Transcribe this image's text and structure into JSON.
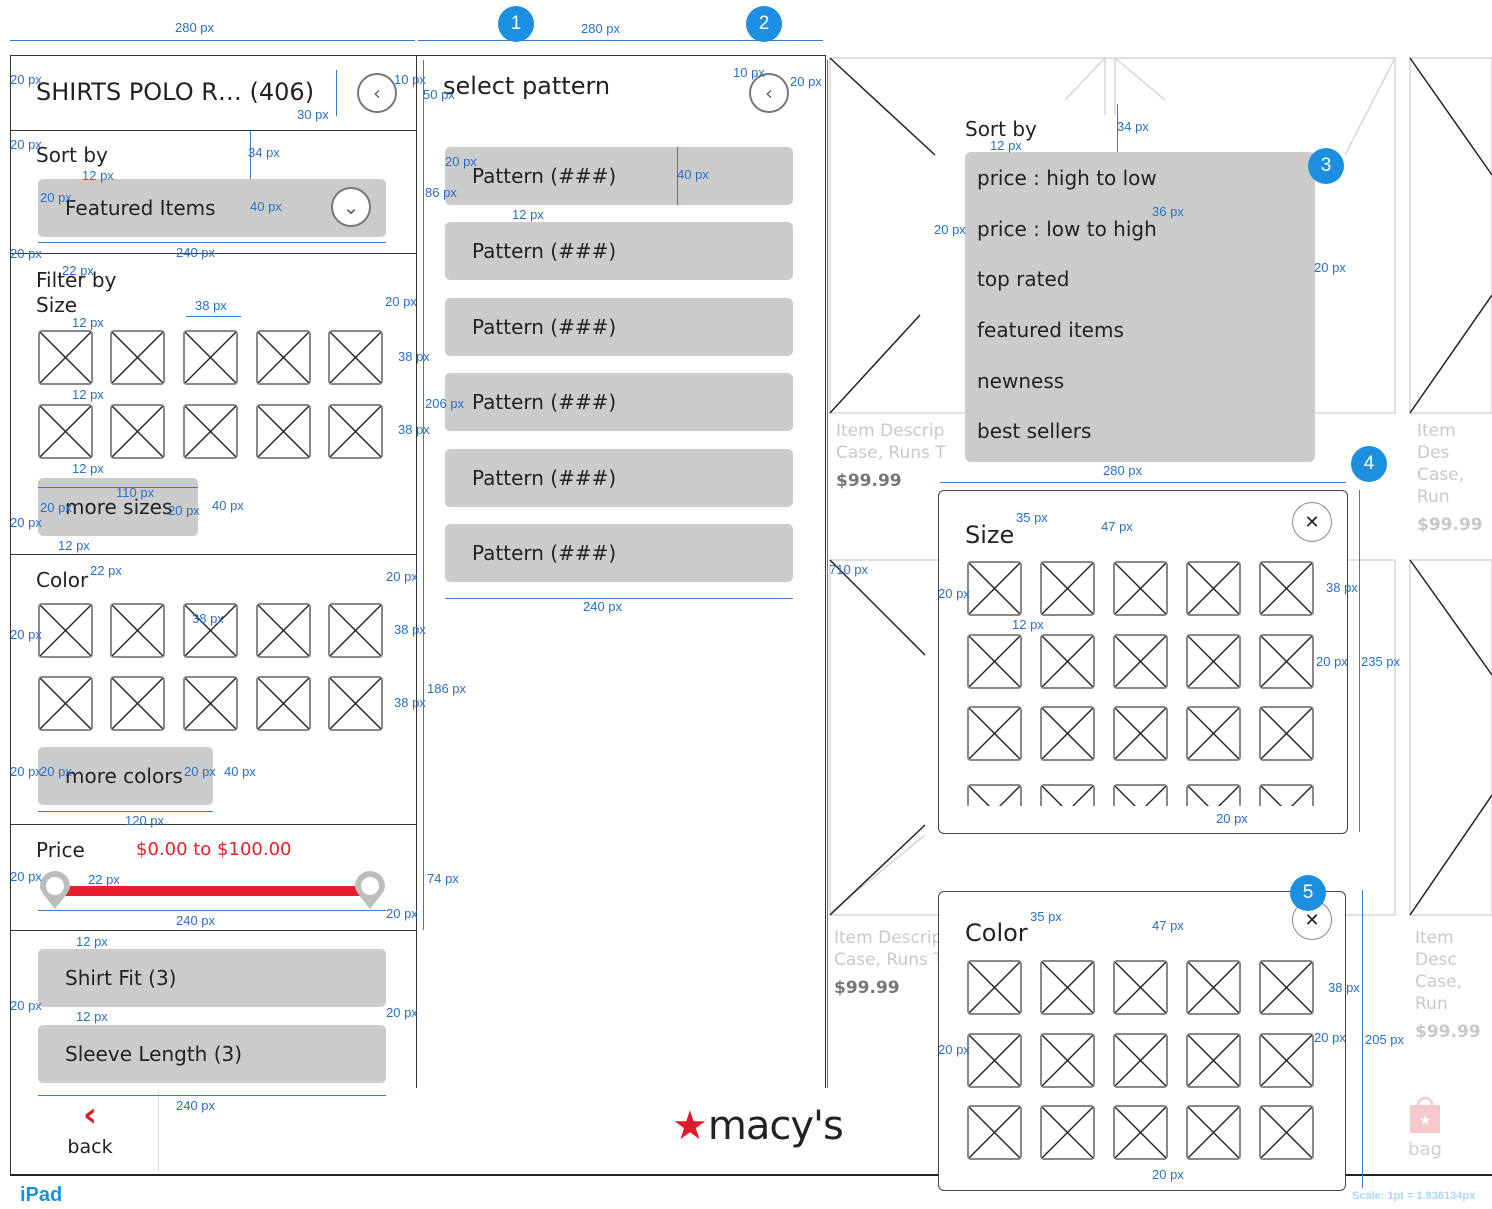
{
  "left_panel": {
    "title": "SHIRTS POLO R… (406)",
    "sort_heading": "Sort by",
    "sort_value": "Featured Items",
    "filter_heading": "Filter by",
    "size_heading": "Size",
    "more_sizes": "more sizes",
    "color_heading": "Color",
    "more_colors": "more colors",
    "price_heading": "Price",
    "price_range": "$0.00 to $100.00",
    "shirt_fit": "Shirt Fit (3)",
    "sleeve_length": "Sleeve Length (3)"
  },
  "pattern_panel": {
    "title": "select pattern",
    "items": [
      "Pattern (###)",
      "Pattern (###)",
      "Pattern (###)",
      "Pattern (###)",
      "Pattern (###)",
      "Pattern (###)"
    ]
  },
  "sort_dropdown": {
    "heading": "Sort by",
    "options": [
      "price : high to low",
      "price : low to high",
      "top rated",
      "featured items",
      "newness",
      "best sellers"
    ]
  },
  "size_popup": {
    "heading": "Size"
  },
  "color_popup": {
    "heading": "Color"
  },
  "products": [
    {
      "desc_line1": "Item Descrip",
      "desc_line2": "Case, Runs T",
      "price": "$99.99"
    },
    {
      "desc_line1": "Item Descrip",
      "desc_line2": "Case, Runs T",
      "price": "$99.99"
    },
    {
      "desc_line1": "Item Des",
      "desc_line2": "Case, Run",
      "price": "$99.99"
    },
    {
      "desc_line1": "Item Desc",
      "desc_line2": "Case, Run",
      "price": "$99.99"
    }
  ],
  "bottom_bar": {
    "back_label": "back",
    "brand": "macy's",
    "bag_label": "bag"
  },
  "badges": [
    "1",
    "2",
    "3",
    "4",
    "5"
  ],
  "device_label": "iPad",
  "scale_note": "Scale: 1pt = 1.836134px",
  "measurements": {
    "w280a": "280 px",
    "w280b": "280 px",
    "w280c": "280 px",
    "p20": "20 px",
    "p10": "10 px",
    "p50": "50 px",
    "p30": "30 px",
    "p34": "34 px",
    "p12": "12 px",
    "p40": "40 px",
    "p240": "240 px",
    "p22": "22 px",
    "p38": "38 px",
    "p110": "110 px",
    "p120": "120 px",
    "p86": "86 px",
    "p206": "206 px",
    "p186": "186 px",
    "p74": "74 px",
    "p710": "710 px",
    "p36": "36 px",
    "p35": "35 px",
    "p47": "47 px",
    "p235": "235 px",
    "p205": "205 px"
  },
  "colors": {
    "accent_blue": "#1c8fe0",
    "price_red": "#e8202b",
    "button_gray": "#cbcbcb",
    "brand_red": "#e11a2b"
  }
}
